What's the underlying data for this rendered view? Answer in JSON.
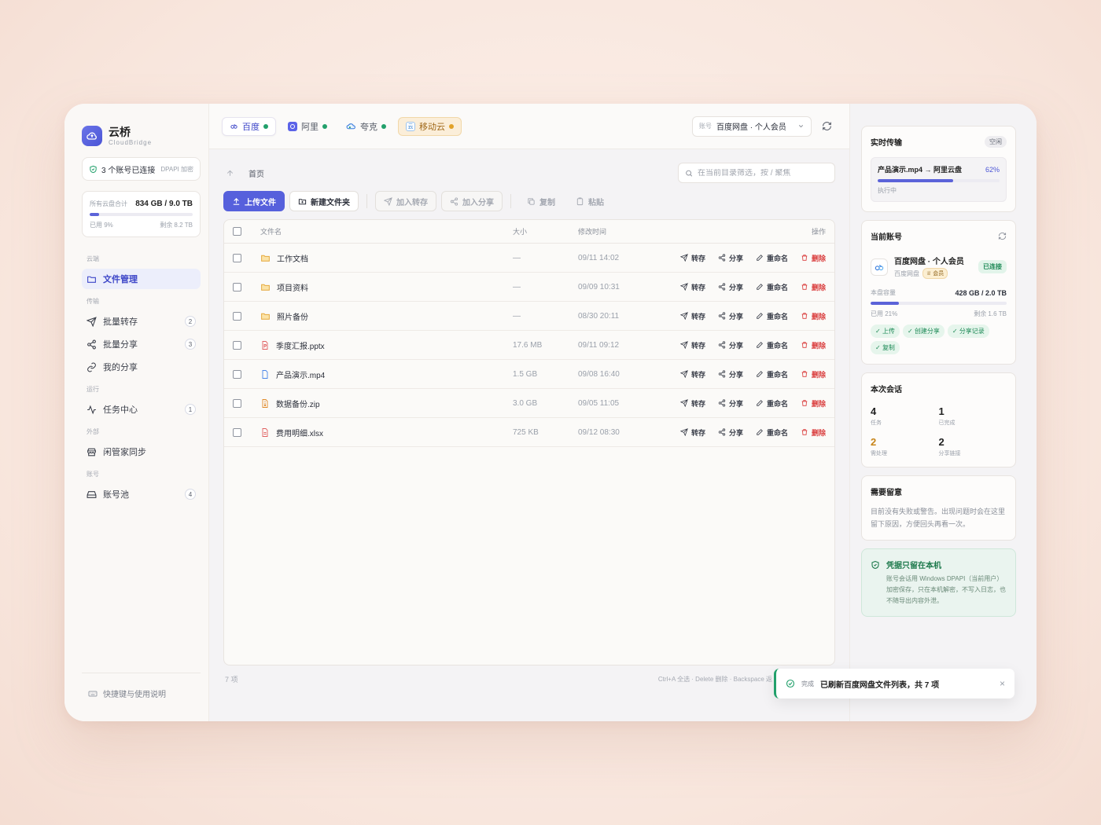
{
  "brand": {
    "name": "云桥",
    "sub": "CloudBridge"
  },
  "connection": {
    "text": "3 个账号已连接",
    "tag": "DPAPI 加密"
  },
  "storage": {
    "label": "所有云盘合计",
    "value": "834 GB / 9.0 TB",
    "used": "已用 9%",
    "remain": "剩余 8.2 TB",
    "used_fraction": 0.09
  },
  "nav": {
    "sec_cloud": "云端",
    "file_mgmt": "文件管理",
    "sec_transfer": "传输",
    "batch_save": "批量转存",
    "batch_save_count": "2",
    "batch_share": "批量分享",
    "batch_share_count": "3",
    "my_share": "我的分享",
    "sec_run": "运行",
    "tasks": "任务中心",
    "tasks_count": "1",
    "sec_ext": "外部",
    "xianguanjia": "闲管家同步",
    "sec_acct": "账号",
    "acct_pool": "账号池",
    "acct_pool_count": "4",
    "footer": "快捷键与使用说明"
  },
  "tabs": [
    {
      "label": "百度"
    },
    {
      "label": "阿里"
    },
    {
      "label": "夸克"
    },
    {
      "label": "移动云"
    }
  ],
  "account_select": {
    "key": "账号",
    "value": "百度网盘 · 个人会员"
  },
  "path": {
    "crumb": "首页"
  },
  "search": {
    "placeholder": "在当前目录筛选，按 / 聚焦"
  },
  "toolbar": {
    "upload": "上传文件",
    "new_folder": "新建文件夹",
    "add_save": "加入转存",
    "add_share": "加入分享",
    "copy": "复制",
    "paste": "粘贴"
  },
  "table": {
    "headers": {
      "name": "文件名",
      "size": "大小",
      "time": "修改时间",
      "ops": "操作"
    },
    "ops": {
      "save": "转存",
      "share": "分享",
      "rename": "重命名",
      "delete": "删除"
    },
    "rows": [
      {
        "name": "工作文档",
        "size": "—",
        "time": "09/11 14:02",
        "icon": "folder-icon"
      },
      {
        "name": "项目资料",
        "size": "—",
        "time": "09/09 10:31",
        "icon": "folder-icon"
      },
      {
        "name": "照片备份",
        "size": "—",
        "time": "08/30 20:11",
        "icon": "folder-icon"
      },
      {
        "name": "季度汇报.pptx",
        "size": "17.6 MB",
        "time": "09/11 09:12",
        "icon": "ppt-file-icon"
      },
      {
        "name": "产品演示.mp4",
        "size": "1.5 GB",
        "time": "09/08 16:40",
        "icon": "video-file-icon"
      },
      {
        "name": "数据备份.zip",
        "size": "3.0 GB",
        "time": "09/05 11:05",
        "icon": "zip-file-icon"
      },
      {
        "name": "费用明细.xlsx",
        "size": "725 KB",
        "time": "09/12 08:30",
        "icon": "xlsx-file-icon"
      }
    ]
  },
  "status": {
    "count": "7 项",
    "hint": "Ctrl+A 全选 · Delete 删除 · Backspace 返"
  },
  "realtime": {
    "title": "实时传输",
    "badge": "空闲",
    "item": "产品演示.mp4 → 阿里云盘",
    "percent": "62%",
    "progress": 0.62,
    "state": "执行中"
  },
  "current_account": {
    "title": "当前账号",
    "name": "百度网盘 · 个人会员",
    "provider": "百度网盘",
    "vip": "会员",
    "status": "已连接",
    "capacity_label": "本盘容量",
    "capacity": "428 GB / 2.0 TB",
    "used": "已用 21%",
    "remain": "剩余 1.6 TB",
    "used_fraction": 0.21,
    "chips": [
      "上传",
      "创建分享",
      "分享记录",
      "复制"
    ]
  },
  "session": {
    "title": "本次会话",
    "stats": [
      {
        "num": "4",
        "label": "任务"
      },
      {
        "num": "1",
        "label": "已完成"
      },
      {
        "num": "2",
        "label": "需处理"
      },
      {
        "num": "2",
        "label": "分享链接"
      }
    ]
  },
  "attention": {
    "title": "需要留意",
    "text": "目前没有失败或警告。出现问题时会在这里留下原因，方便回头再看一次。"
  },
  "secure": {
    "title": "凭据只留在本机",
    "text": "账号会话用 Windows DPAPI（当前用户）加密保存，只在本机解密，不写入日志，也不随导出内容外泄。"
  },
  "toast": {
    "key": "完成",
    "message": "已刷新百度网盘文件列表，共 7 项",
    "close": "×"
  },
  "colors": {
    "accent": "#5660dc",
    "success": "#22a06b",
    "danger": "#d93a3a",
    "warn": "#e1a128"
  }
}
